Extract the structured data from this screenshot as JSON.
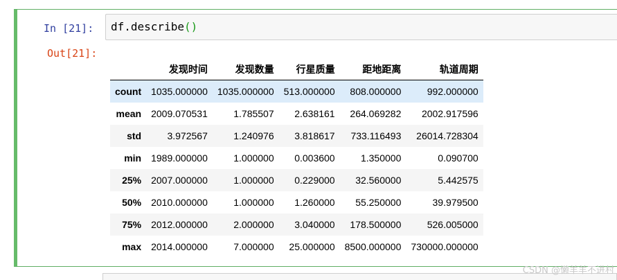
{
  "notebook": {
    "in_prompt": "In  [21]:",
    "out_prompt": "Out[21]:",
    "code_text": "df.describe",
    "code_parens": "()"
  },
  "table": {
    "columns": [
      "",
      "发现时间",
      "发现数量",
      "行星质量",
      "距地距离",
      "轨道周期"
    ],
    "rows": [
      {
        "label": "count",
        "values": [
          "1035.000000",
          "1035.000000",
          "513.000000",
          "808.000000",
          "992.000000"
        ]
      },
      {
        "label": "mean",
        "values": [
          "2009.070531",
          "1.785507",
          "2.638161",
          "264.069282",
          "2002.917596"
        ]
      },
      {
        "label": "std",
        "values": [
          "3.972567",
          "1.240976",
          "3.818617",
          "733.116493",
          "26014.728304"
        ]
      },
      {
        "label": "min",
        "values": [
          "1989.000000",
          "1.000000",
          "0.003600",
          "1.350000",
          "0.090700"
        ]
      },
      {
        "label": "25%",
        "values": [
          "2007.000000",
          "1.000000",
          "0.229000",
          "32.560000",
          "5.442575"
        ]
      },
      {
        "label": "50%",
        "values": [
          "2010.000000",
          "1.000000",
          "1.260000",
          "55.250000",
          "39.979500"
        ]
      },
      {
        "label": "75%",
        "values": [
          "2012.000000",
          "2.000000",
          "3.040000",
          "178.500000",
          "526.005000"
        ]
      },
      {
        "label": "max",
        "values": [
          "2014.000000",
          "7.000000",
          "25.000000",
          "8500.000000",
          "730000.000000"
        ]
      }
    ]
  },
  "watermark": "CSDN @懒羊羊不进村",
  "colors": {
    "cell_border": "#66bb6a",
    "in_prompt": "#303f9f",
    "out_prompt": "#d84315",
    "hover_row": "#dcecfa"
  }
}
